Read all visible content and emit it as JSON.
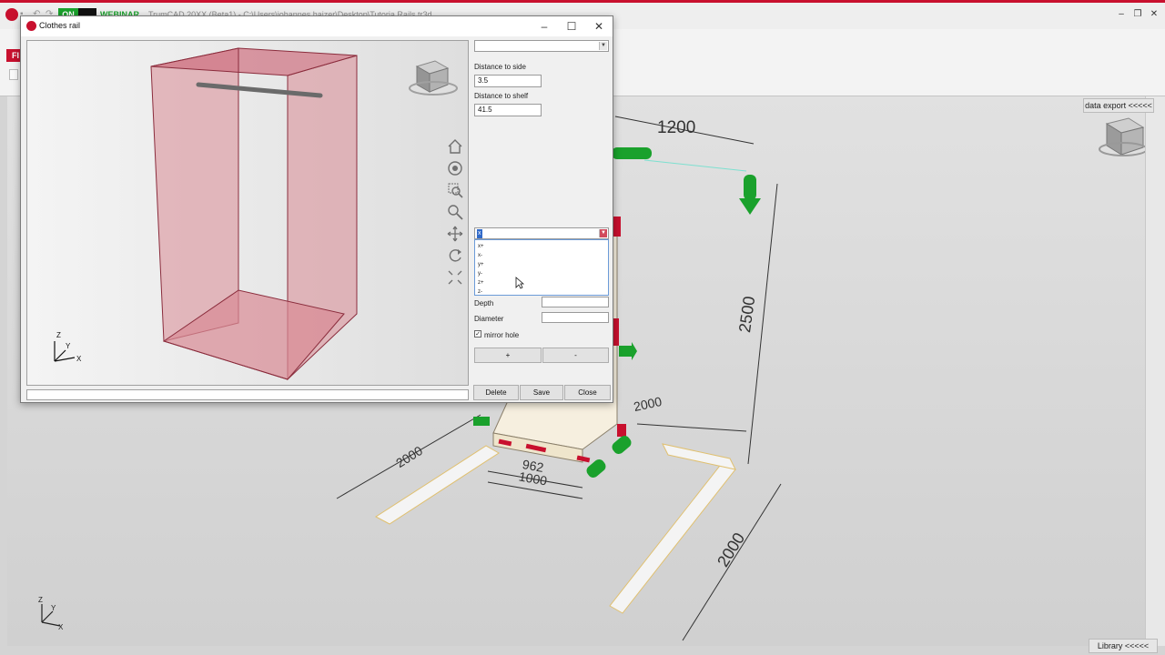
{
  "app": {
    "title": "TrumCAD 20XX (Beta1) - C:\\Users\\johannes.haizer\\Desktop\\Tutoria Rails.tr3d",
    "badge_on": "ON",
    "badge_webinar": "WEBINAR",
    "ribbon_tab": "FI",
    "data_export_label": "data export <<<<<",
    "library_label": "Library <<<<<"
  },
  "scene": {
    "dimensions": [
      "1200",
      "2500",
      "2000",
      "2000",
      "2000",
      "962",
      "1000"
    ],
    "colors": {
      "accent": "#c8102e",
      "arrow_green": "#1aa12c",
      "highlight": "#d24a5c"
    }
  },
  "dialog": {
    "title": "Clothes rail",
    "top_select_value": "",
    "distance_side_label": "Distance to side",
    "distance_side_value": "3.5",
    "distance_shelf_label": "Distance to shelf",
    "distance_shelf_value": "41.5",
    "direction_select_value": "x",
    "direction_options": [
      "x+",
      "x-",
      "y+",
      "y-",
      "z+",
      "z-"
    ],
    "depth_label": "Depth",
    "depth_value": "",
    "diameter_label": "Diameter",
    "diameter_value": "",
    "mirror_hole_label": "mirror hole",
    "mirror_hole_checked": "✓",
    "add_label": "+",
    "remove_label": "-",
    "delete_label": "Delete",
    "save_label": "Save",
    "close_label": "Close",
    "nav_icons": [
      "home-icon",
      "view-icon",
      "zoom-window-icon",
      "zoom-icon",
      "pan-icon",
      "rotate-icon",
      "fit-icon"
    ]
  }
}
